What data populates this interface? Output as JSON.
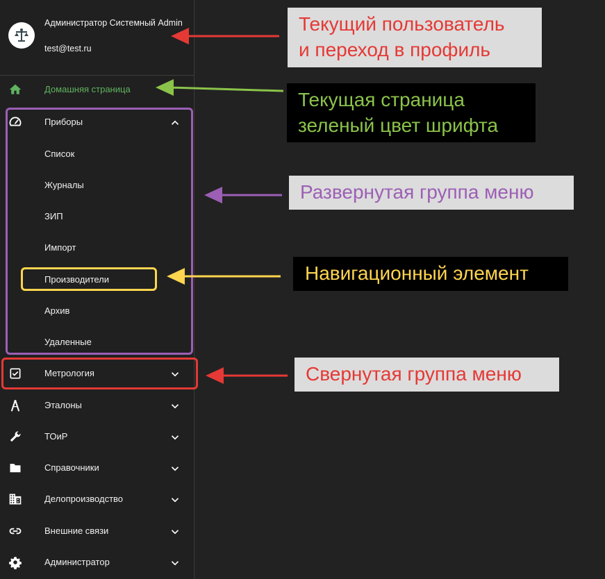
{
  "user": {
    "name": "Администратор Системный Admin",
    "email": "test@test.ru",
    "avatar_icon": "scales-icon"
  },
  "nav": {
    "home": {
      "label": "Домашняя страница",
      "icon": "home-icon",
      "active": true
    },
    "pribory": {
      "label": "Приборы",
      "icon": "speedometer-icon",
      "expanded": true,
      "children": [
        "Список",
        "Журналы",
        "ЗИП",
        "Импорт",
        "Производители",
        "Архив",
        "Удаленные"
      ]
    },
    "groups": [
      {
        "label": "Метрология",
        "icon": "checkbox-icon"
      },
      {
        "label": "Эталоны",
        "icon": "compass-icon"
      },
      {
        "label": "ТОиР",
        "icon": "wrench-icon"
      },
      {
        "label": "Справочники",
        "icon": "folder-icon"
      },
      {
        "label": "Делопроизводство",
        "icon": "building-icon"
      },
      {
        "label": "Внешние связи",
        "icon": "link-icon"
      },
      {
        "label": "Администратор",
        "icon": "gear-icon"
      }
    ]
  },
  "callouts": {
    "user": "Текущий пользователь\nи переход в профиль",
    "current_page": "Текущая страница\nзеленый цвет шрифта",
    "expanded_group": "Развернутая группа меню",
    "nav_element": "Навигационный элемент",
    "collapsed_group": "Свернутая группа меню"
  },
  "colors": {
    "active_text": "#5fb35f",
    "red": "#e53935",
    "green": "#8bc34a",
    "purple": "#9c5fb5",
    "yellow": "#ffd54f"
  }
}
